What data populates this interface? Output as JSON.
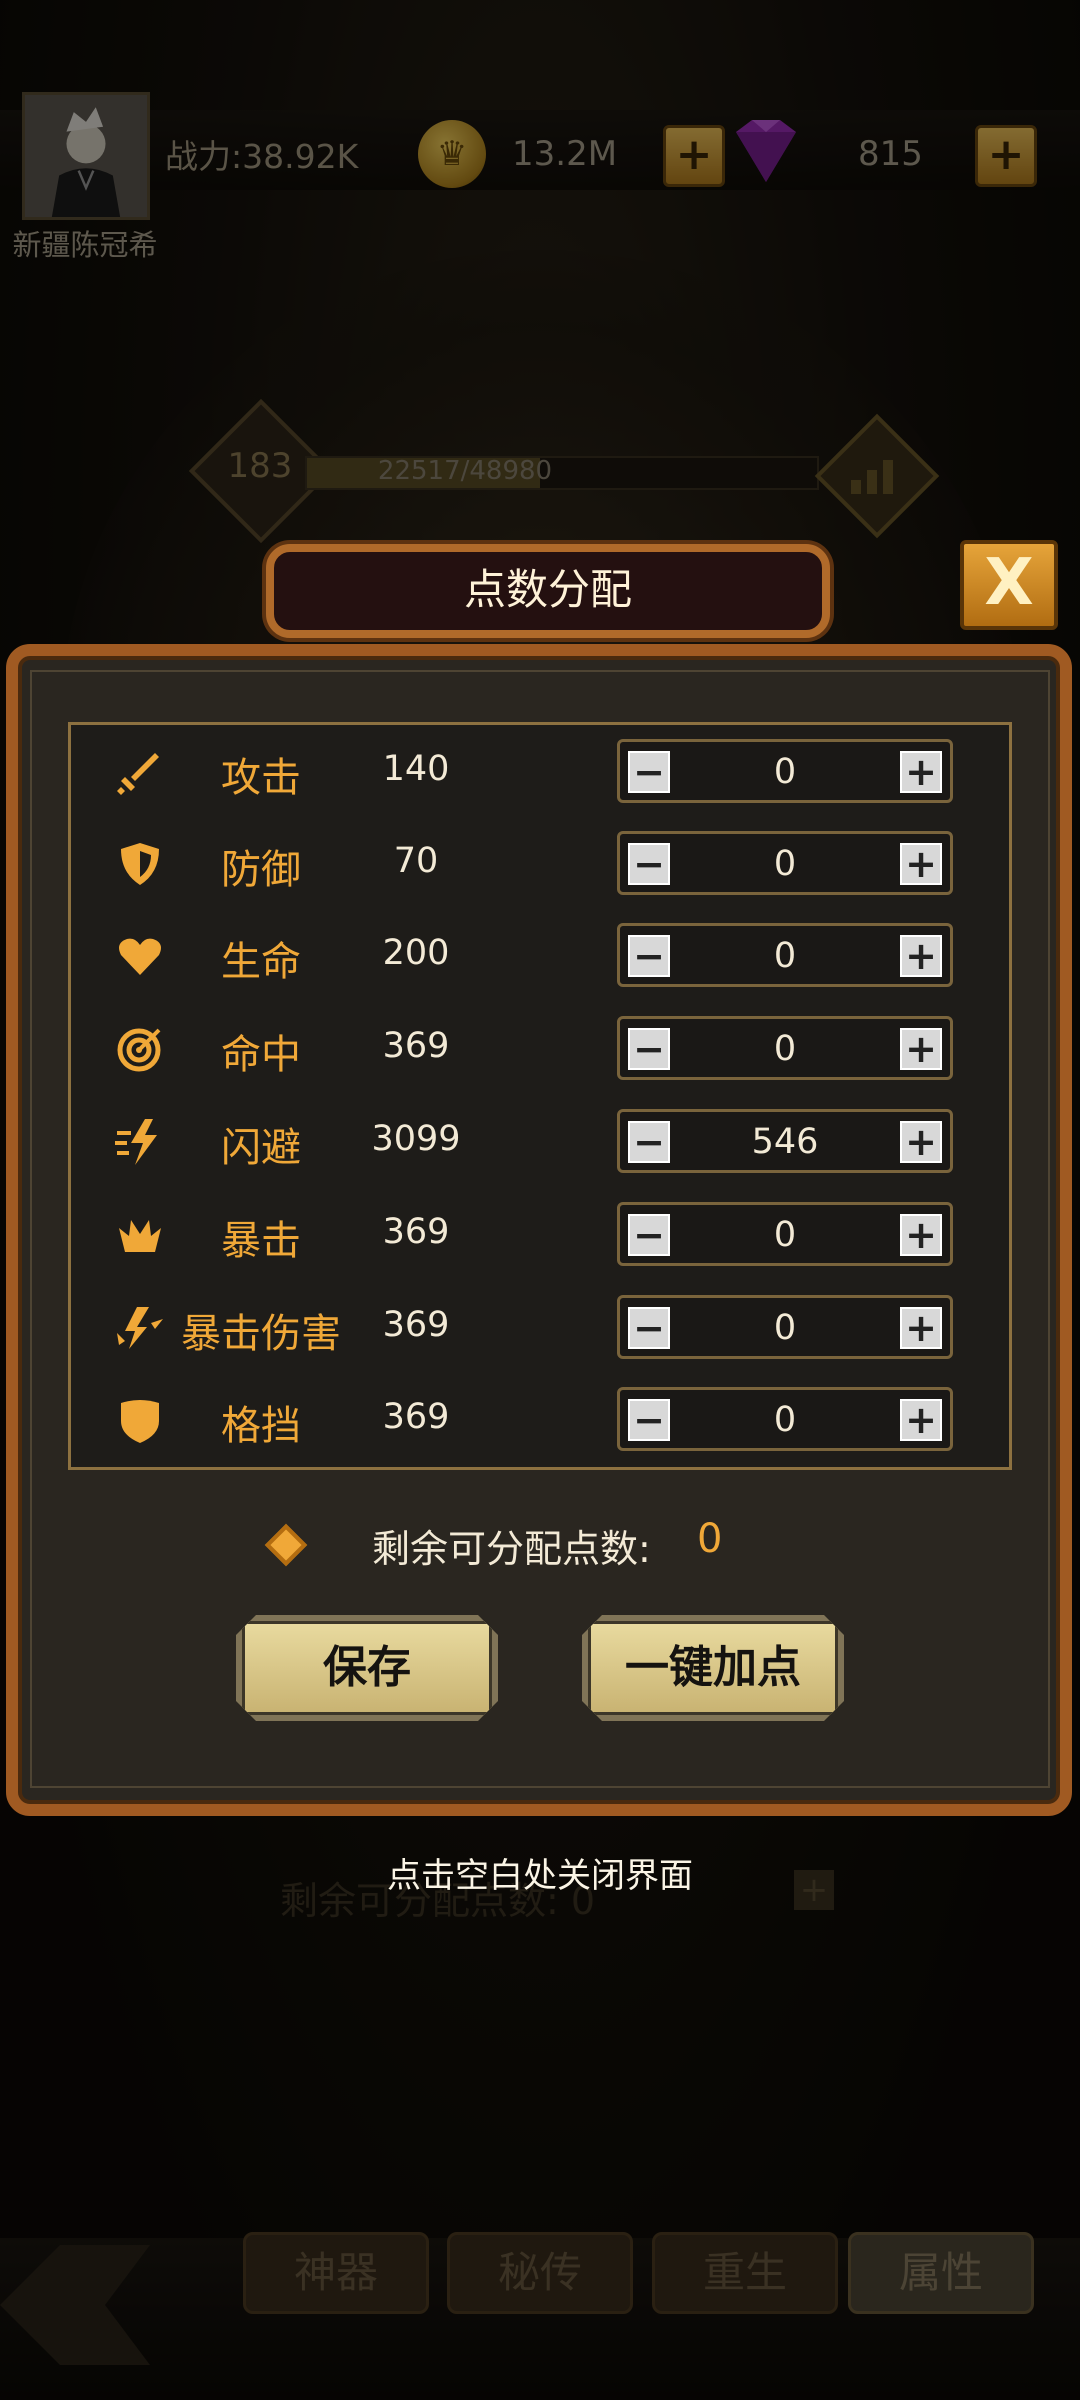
{
  "header": {
    "username": "新疆陈冠希",
    "power": "战力:38.92K",
    "coins": "13.2M",
    "gems": "815",
    "coin_icon_glyph": "♛",
    "plus_glyph": "+"
  },
  "level": {
    "value": "183",
    "exp_text": "22517/48980",
    "exp_fraction": 0.46
  },
  "dialog": {
    "title": "点数分配",
    "close_glyph": "X",
    "remaining_label": "剩余可分配点数:",
    "remaining_value": "0",
    "save_label": "保存",
    "auto_label": "一键加点",
    "hint": "点击空白处关闭界面"
  },
  "stats": [
    {
      "name": "攻击",
      "value": "140",
      "alloc": "0",
      "icon": "sword-icon"
    },
    {
      "name": "防御",
      "value": "70",
      "alloc": "0",
      "icon": "shield-icon"
    },
    {
      "name": "生命",
      "value": "200",
      "alloc": "0",
      "icon": "heart-icon"
    },
    {
      "name": "命中",
      "value": "369",
      "alloc": "0",
      "icon": "target-icon"
    },
    {
      "name": "闪避",
      "value": "3099",
      "alloc": "546",
      "icon": "dodge-icon"
    },
    {
      "name": "暴击",
      "value": "369",
      "alloc": "0",
      "icon": "crit-icon"
    },
    {
      "name": "暴击伤害",
      "value": "369",
      "alloc": "0",
      "icon": "crit-damage-icon"
    },
    {
      "name": "格挡",
      "value": "369",
      "alloc": "0",
      "icon": "block-icon"
    }
  ],
  "stepper": {
    "minus": "−",
    "plus": "+"
  },
  "behind": {
    "remaining_label": "剩余可分配点数:",
    "remaining_value": "0"
  },
  "tabs": {
    "artifact": "神器",
    "secret": "秘传",
    "rebirth": "重生",
    "attribute": "属性"
  },
  "colors": {
    "accent": "#f0a838",
    "panel_border": "#a05a22",
    "button_face": "#e9dba0"
  }
}
